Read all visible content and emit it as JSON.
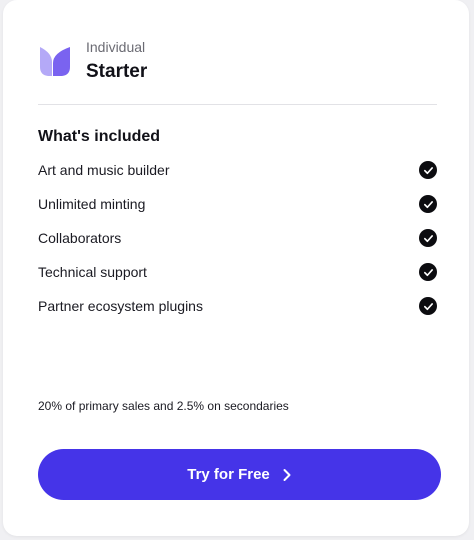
{
  "plan": {
    "tier_label": "Individual",
    "name": "Starter",
    "logo_icon": "brand-logo-icon"
  },
  "included": {
    "title": "What's included",
    "features": [
      {
        "label": "Art and music builder",
        "icon": "check-circle-icon"
      },
      {
        "label": "Unlimited minting",
        "icon": "check-circle-icon"
      },
      {
        "label": "Collaborators",
        "icon": "check-circle-icon"
      },
      {
        "label": "Technical support",
        "icon": "check-circle-icon"
      },
      {
        "label": "Partner ecosystem plugins",
        "icon": "check-circle-icon"
      }
    ]
  },
  "fees": "20% of primary sales and 2.5% on secondaries",
  "cta": {
    "label": "Try for Free",
    "icon": "chevron-right-icon"
  },
  "colors": {
    "accent": "#4534e8",
    "logo_light": "#b4a9f7",
    "logo_dark": "#7a63f0",
    "check_bg": "#0c0c10"
  }
}
